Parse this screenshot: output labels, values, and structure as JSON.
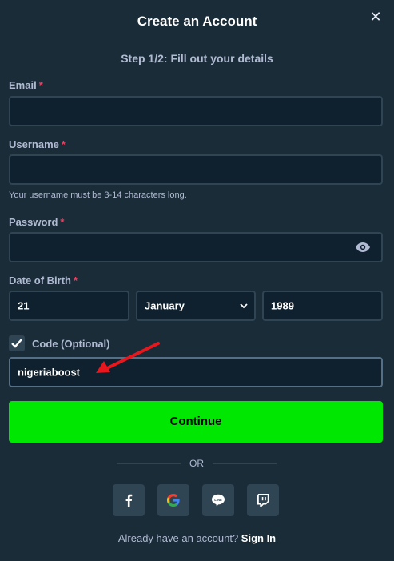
{
  "modal": {
    "title": "Create an Account",
    "close_icon": "close-icon",
    "step": "Step 1/2: Fill out your details"
  },
  "form": {
    "email": {
      "label": "Email",
      "required_mark": "*",
      "value": ""
    },
    "username": {
      "label": "Username",
      "required_mark": "*",
      "value": "",
      "hint": "Your username must be 3-14 characters long."
    },
    "password": {
      "label": "Password",
      "required_mark": "*",
      "value": "",
      "icon": "eye-icon"
    },
    "dob": {
      "label": "Date of Birth",
      "required_mark": "*",
      "day": "21",
      "month": "January",
      "year": "1989"
    },
    "code": {
      "checked": true,
      "label": "Code (Optional)",
      "value": "nigeriaboost"
    }
  },
  "continue_label": "Continue",
  "divider_text": "OR",
  "social": [
    {
      "name": "facebook-icon"
    },
    {
      "name": "google-icon"
    },
    {
      "name": "line-icon"
    },
    {
      "name": "twitch-icon"
    }
  ],
  "footer": {
    "prompt": "Already have an account?",
    "link": "Sign In"
  },
  "colors": {
    "background": "#1a2c38",
    "input_bg": "#0f212e",
    "border": "#2f4553",
    "accent": "#00e701",
    "required": "#ed4163",
    "arrow": "#e8171d"
  }
}
